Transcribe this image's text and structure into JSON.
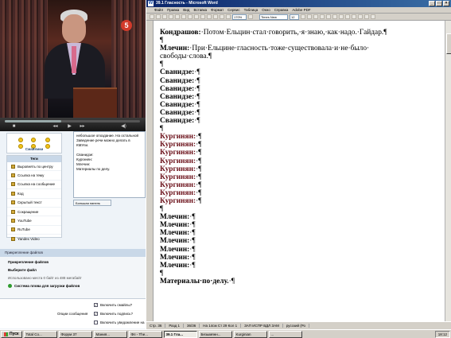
{
  "video": {
    "channel_logo": "5",
    "progress": 0.42
  },
  "browser": {
    "smileys_label": "Смайлики",
    "tags": {
      "title": "Теги",
      "items": [
        "Выровнять по центру",
        "Ссылка на тему",
        "Ссылка на сообщение",
        "Код",
        "Скрытый текст",
        "Сокращение",
        "YouTube",
        "RuTube",
        "Yandex Video"
      ]
    },
    "message_text": "небольшое опоздание. На остальной\nЗаведение речи можно делать в КМУли.\n\nСванидзе:\nКургинян:\nМлечин:\nМатериалы по делу.",
    "extra_panel_button": "Большая панель",
    "attachments": {
      "header": "Прикрепление файлов",
      "title": "Прикрепление файлов",
      "choose_file": "Выберите файл",
      "usage": "Использовано места 0 байт из 488 мегабайт",
      "system": "Система плова для загрузки файлов"
    },
    "options": {
      "label": "Опции сообщения",
      "items": [
        "Включить смайлы?",
        "Включить подпись?",
        "Включить уведомление на"
      ]
    }
  },
  "word": {
    "title": "39.1 Гласность - Microsoft Word",
    "icon": "W",
    "menu": [
      "Файл",
      "Правка",
      "Вид",
      "Вставка",
      "Формат",
      "Сервис",
      "Таблица",
      "Окно",
      "Справка",
      "Adobe PDF"
    ],
    "toolbar": {
      "zoom": "170%",
      "font": "Times New Roman",
      "size": "12"
    },
    "doc": [
      {
        "speaker": "Кондрашов:",
        "text": "Потом·Ельцин·стал·говорить,·я·знаю,·как·надо.·Гайдар.",
        "color": "#000",
        "wrap": false
      },
      {
        "speaker": "",
        "text": "",
        "color": "#000"
      },
      {
        "speaker": "Млечин:",
        "text": "При·Ельцине·гласность·тоже·существовала·и·не·было·",
        "color": "#000"
      },
      {
        "speaker": "",
        "text": "свободы·слова.",
        "color": "#000",
        "plain": true
      },
      {
        "speaker": "",
        "text": "",
        "color": "#000"
      },
      {
        "speaker": "Сванидзе:",
        "text": "",
        "color": "#000"
      },
      {
        "speaker": "Сванидзе:",
        "text": "",
        "color": "#000"
      },
      {
        "speaker": "Сванидзе:",
        "text": "",
        "color": "#000"
      },
      {
        "speaker": "Сванидзе:",
        "text": "",
        "color": "#000"
      },
      {
        "speaker": "Сванидзе:",
        "text": "",
        "color": "#000"
      },
      {
        "speaker": "Сванидзе:",
        "text": "",
        "color": "#000"
      },
      {
        "speaker": "Сванидзе:",
        "text": "",
        "color": "#000"
      },
      {
        "speaker": "",
        "text": "",
        "color": "#000"
      },
      {
        "speaker": "Кургинян:",
        "text": "",
        "color": "#6a0f18"
      },
      {
        "speaker": "Кургинян:",
        "text": "",
        "color": "#6a0f18"
      },
      {
        "speaker": "Кургинян:",
        "text": "",
        "color": "#6a0f18"
      },
      {
        "speaker": "Кургинян:",
        "text": "",
        "color": "#6a0f18"
      },
      {
        "speaker": "Кургинян:",
        "text": "",
        "color": "#6a0f18"
      },
      {
        "speaker": "Кургинян:",
        "text": "",
        "color": "#6a0f18"
      },
      {
        "speaker": "Кургинян:",
        "text": "",
        "color": "#6a0f18"
      },
      {
        "speaker": "Кургинян:",
        "text": "",
        "color": "#6a0f18"
      },
      {
        "speaker": "Кургинян:",
        "text": "",
        "color": "#6a0f18"
      },
      {
        "speaker": "",
        "text": "",
        "color": "#000"
      },
      {
        "speaker": "Млечин:",
        "text": "",
        "color": "#000"
      },
      {
        "speaker": "Млечин:",
        "text": "",
        "color": "#000"
      },
      {
        "speaker": "Млечин:",
        "text": "",
        "color": "#000"
      },
      {
        "speaker": "Млечин:",
        "text": "",
        "color": "#000"
      },
      {
        "speaker": "Млечин:",
        "text": "",
        "color": "#000"
      },
      {
        "speaker": "Млечин:",
        "text": "",
        "color": "#000"
      },
      {
        "speaker": "Млечин:",
        "text": "",
        "color": "#000"
      },
      {
        "speaker": "",
        "text": "",
        "color": "#000"
      },
      {
        "speaker": "Материалы·по·делу.",
        "text": "",
        "color": "#000"
      }
    ],
    "pilcrow": "¶",
    "status": [
      "Стр. 36",
      "Разд 1",
      "36/36",
      "На 14см  Ст 29  Кол 1",
      "ЗАП ИСПР ВДЛ ЗАМ",
      "русский (Ро"
    ]
  },
  "taskbar": {
    "start": "Пуск",
    "tasks": [
      "Total Co...",
      "Форум 37",
      "Мания...",
      "Фл - The...",
      "39.1 Гла...",
      "Безымянн...",
      "Kurginian",
      "..."
    ],
    "active_index": 4,
    "clock": "18:12"
  },
  "colors": {
    "accent": "#0a246a",
    "red_speaker": "#6a0f18"
  }
}
